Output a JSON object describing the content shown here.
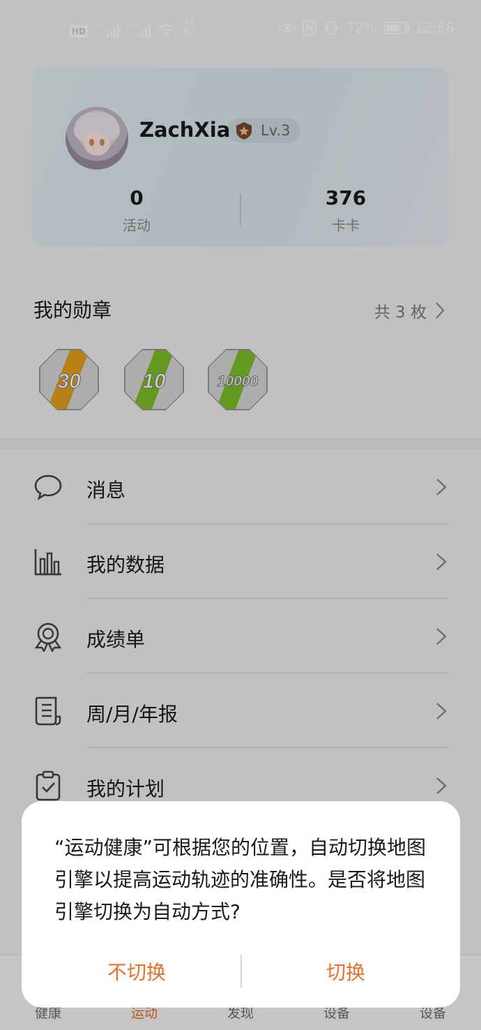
{
  "status_bar": {
    "hd": "HD",
    "sim1_tag": "4G",
    "sim2_tag": "2G",
    "net_speed_value": "61",
    "net_speed_unit": "B/s",
    "battery_percent": "72%",
    "battery_level": 0.72,
    "time": "12:56",
    "icons": [
      "eye-comfort-icon",
      "nfc-icon",
      "vibrate-icon",
      "wifi-icon"
    ]
  },
  "profile": {
    "username": "ZachXia",
    "level": "Lv.3",
    "stats": [
      {
        "value": "0",
        "label": "活动"
      },
      {
        "value": "376",
        "label": "卡卡"
      }
    ]
  },
  "medals": {
    "title": "我的勋章",
    "count_text": "共 3 枚",
    "items": [
      {
        "value": "30",
        "stripe_color": "#e5a21f"
      },
      {
        "value": "10",
        "stripe_color": "#7fbf2a"
      },
      {
        "value": "10000",
        "stripe_color": "#7fbf2a"
      }
    ]
  },
  "menu": [
    {
      "label": "消息",
      "icon": "message-icon"
    },
    {
      "label": "我的数据",
      "icon": "data-chart-icon"
    },
    {
      "label": "成绩单",
      "icon": "award-icon"
    },
    {
      "label": "周/月/年报",
      "icon": "report-icon"
    },
    {
      "label": "我的计划",
      "icon": "plan-clipboard-icon"
    }
  ],
  "bottom_nav": [
    {
      "label": "健康",
      "active": false
    },
    {
      "label": "运动",
      "active": true
    },
    {
      "label": "发现",
      "active": false
    },
    {
      "label": "设备",
      "active": false
    },
    {
      "label": "设备",
      "active": false
    }
  ],
  "dialog": {
    "message": "“运动健康”可根据您的位置，自动切换地图引擎以提高运动轨迹的准确性。是否将地图引擎切换为自动方式?",
    "cancel_label": "不切换",
    "confirm_label": "切换"
  },
  "colors": {
    "accent": "#e8702a",
    "background": "#f2f2f2",
    "card_gradient_start": "#e4f0f4"
  }
}
